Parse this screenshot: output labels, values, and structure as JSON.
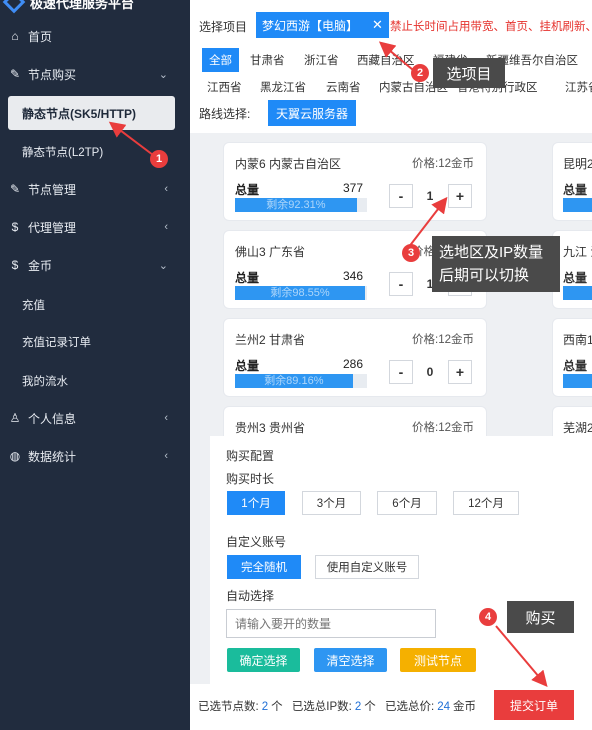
{
  "logo": {
    "text": "极速代理服务平台"
  },
  "sidebar": {
    "items": [
      {
        "label": "首页",
        "icon": "⌂"
      },
      {
        "label": "节点购买",
        "icon": "⚒"
      },
      {
        "label": "静态节点(SK5/HTTP)",
        "icon": ""
      },
      {
        "label": "静态节点(L2TP)",
        "icon": ""
      },
      {
        "label": "节点管理",
        "icon": "⚒"
      },
      {
        "label": "代理管理",
        "icon": "$"
      },
      {
        "label": "金币",
        "icon": "$"
      },
      {
        "label": "充值",
        "icon": ""
      },
      {
        "label": "充值记录订单",
        "icon": ""
      },
      {
        "label": "我的流水",
        "icon": ""
      },
      {
        "label": "个人信息",
        "icon": "♙"
      },
      {
        "label": "数据统计",
        "icon": "◍"
      }
    ]
  },
  "filters": {
    "project_label": "选择项目",
    "project_tag": "梦幻西游【电脑】",
    "project_close": "✕",
    "warning": "禁止长时间占用带宽、首页、挂机刷新、",
    "provinces_row1": [
      "全部",
      "甘肃省",
      "浙江省",
      "西藏自治区",
      "福建省",
      "新疆维吾尔自治区"
    ],
    "provinces_row2": [
      "江西省",
      "黑龙江省",
      "云南省",
      "内蒙古自治区",
      "香港特别行政区",
      "江苏省"
    ],
    "route_label": "路线选择:",
    "route_button": "天翼云服务器"
  },
  "nodes": [
    {
      "name": "内蒙6 内蒙古自治区",
      "price": "价格:12金币",
      "total_label": "总量",
      "total": "377",
      "remaining": "剩余92.31%",
      "remaining_fraction": 0.9231,
      "qty": "1"
    },
    {
      "name": "佛山3 广东省",
      "price": "价格:12金币",
      "total_label": "总量",
      "total": "346",
      "remaining": "剩余98.55%",
      "remaining_fraction": 0.9855,
      "qty": "1"
    },
    {
      "name": "兰州2 甘肃省",
      "price": "价格:12金币",
      "total_label": "总量",
      "total": "286",
      "remaining": "剩余89.16%",
      "remaining_fraction": 0.8916,
      "qty": "0"
    },
    {
      "name": "贵州3 贵州省",
      "price": "价格:12金币",
      "total_label": "总量",
      "total": "",
      "remaining": "",
      "remaining_fraction": 0,
      "qty": ""
    }
  ],
  "nodes_right": [
    {
      "name": "昆明2",
      "total_label": "总量"
    },
    {
      "name": "九江 江",
      "total_label": "总量"
    },
    {
      "name": "西南1",
      "total_label": "总量"
    },
    {
      "name": "芜湖2",
      "total_label": ""
    }
  ],
  "purchase": {
    "title": "购买配置",
    "duration_label": "购买时长",
    "durations": [
      "1个月",
      "3个月",
      "6个月",
      "12个月"
    ],
    "account_label": "自定义账号",
    "account_options": [
      "完全随机",
      "使用自定义账号"
    ],
    "auto_label": "自动选择",
    "auto_placeholder": "请输入要开的数量",
    "actions": [
      "确定选择",
      "清空选择",
      "测试节点"
    ]
  },
  "footer": {
    "nodes_label": "已选节点数:",
    "nodes_value": "2",
    "nodes_unit": "个",
    "ips_label": "已选总IP数:",
    "ips_value": "2",
    "ips_unit": "个",
    "price_label": "已选总价:",
    "price_value": "24",
    "price_unit": "金币",
    "submit": "提交订单"
  },
  "annotations": [
    {
      "num": "1",
      "text": ""
    },
    {
      "num": "2",
      "text": "选项目"
    },
    {
      "num": "3",
      "text": "选地区及IP数量\n后期可以切换"
    },
    {
      "num": "4",
      "text": "购买"
    }
  ],
  "colors": {
    "accent": "#1f8af7",
    "sidebar": "#212c3e",
    "danger": "#e93d3d",
    "teal": "#1abc9c",
    "orange": "#f5b000"
  }
}
